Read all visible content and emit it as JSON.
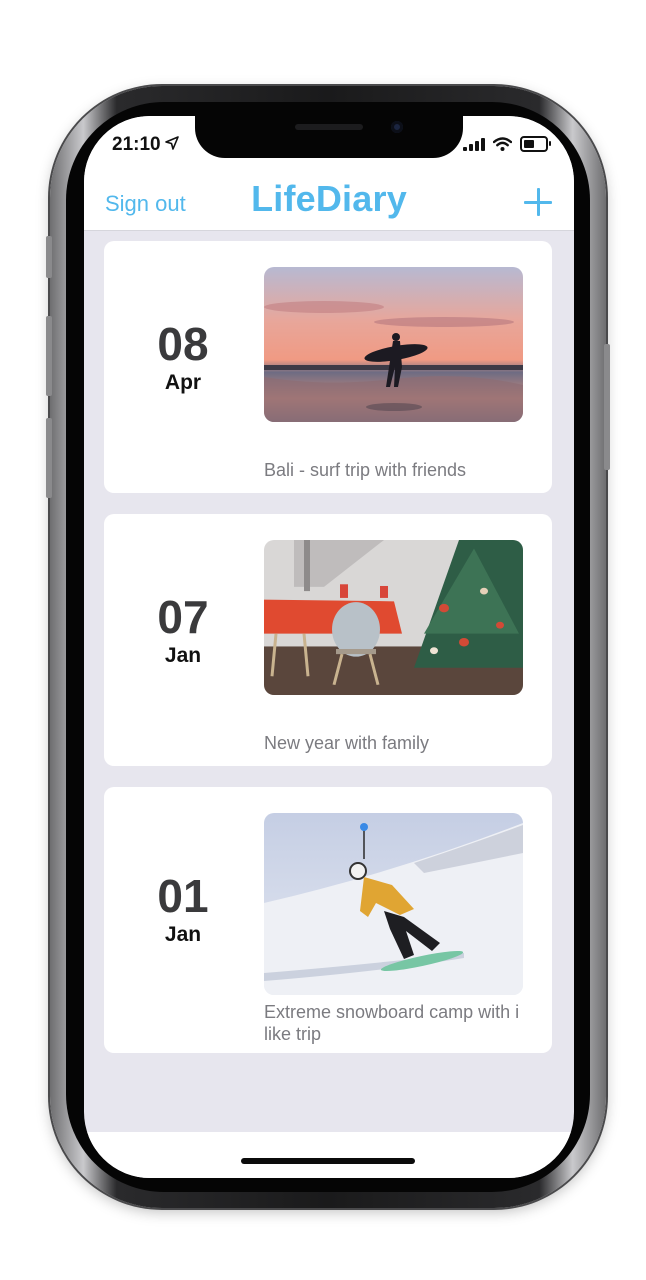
{
  "status_bar": {
    "time": "21:10",
    "location_icon": "location-arrow-icon",
    "signal_icon": "cellular-signal-icon",
    "wifi_icon": "wifi-icon",
    "battery_icon": "battery-icon"
  },
  "nav": {
    "sign_out_label": "Sign out",
    "title": "LifeDiary",
    "add_icon": "plus-icon",
    "accent_color": "#52b8ec"
  },
  "entries": [
    {
      "day": "08",
      "month": "Apr",
      "caption": "Bali - surf trip with friends",
      "image": "surfer-at-sunset-photo"
    },
    {
      "day": "07",
      "month": "Jan",
      "caption": "New year with family",
      "image": "christmas-tree-dining-room-photo"
    },
    {
      "day": "01",
      "month": "Jan",
      "caption": "Extreme snowboard camp with i like trip",
      "image": "snowboarder-on-slope-photo"
    }
  ]
}
